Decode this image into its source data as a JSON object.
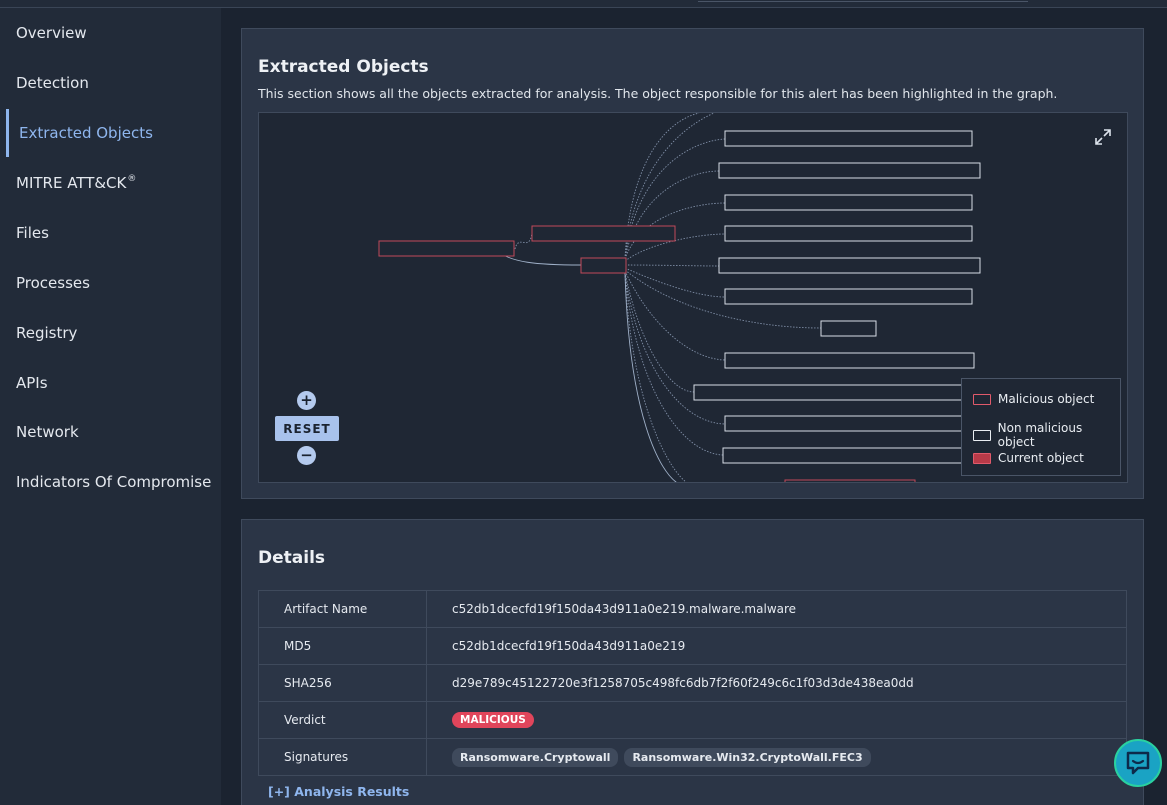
{
  "sidebar": {
    "items": [
      {
        "label": "Overview"
      },
      {
        "label": "Detection"
      },
      {
        "label": "Extracted Objects"
      },
      {
        "label": "MITRE ATT&CK",
        "sup": "®"
      },
      {
        "label": "Files"
      },
      {
        "label": "Processes"
      },
      {
        "label": "Registry"
      },
      {
        "label": "APIs"
      },
      {
        "label": "Network"
      },
      {
        "label": "Indicators Of Compromise"
      }
    ]
  },
  "extracted": {
    "title": "Extracted Objects",
    "description": "This section shows all the objects extracted for analysis. The object responsible for this alert has been highlighted in the graph.",
    "reset_label": "RESET",
    "zoom_in": "+",
    "zoom_out": "−",
    "legend": {
      "malicious": "Malicious object",
      "non_malicious": "Non malicious object",
      "current": "Current object"
    },
    "colors": {
      "malicious": "#e05a6b",
      "non_malicious": "#e9edf2",
      "current": "#b83a48"
    }
  },
  "details": {
    "title": "Details",
    "rows": {
      "artifact_name": {
        "key": "Artifact Name",
        "value": "c52db1dcecfd19f150da43d911a0e219.malware.malware"
      },
      "md5": {
        "key": "MD5",
        "value": "c52db1dcecfd19f150da43d911a0e219"
      },
      "sha256": {
        "key": "SHA256",
        "value": "d29e789c45122720e3f1258705c498fc6db7f2f60f249c6c1f03d3de438ea0dd"
      },
      "verdict": {
        "key": "Verdict",
        "value": "MALICIOUS"
      },
      "signatures": {
        "key": "Signatures",
        "values": [
          "Ransomware.Cryptowall",
          "Ransomware.Win32.CryptoWall.FEC3"
        ]
      }
    },
    "analysis_link": "[+] Analysis Results"
  },
  "icons": {
    "expand": "expand-icon",
    "chat": "chat-icon"
  }
}
